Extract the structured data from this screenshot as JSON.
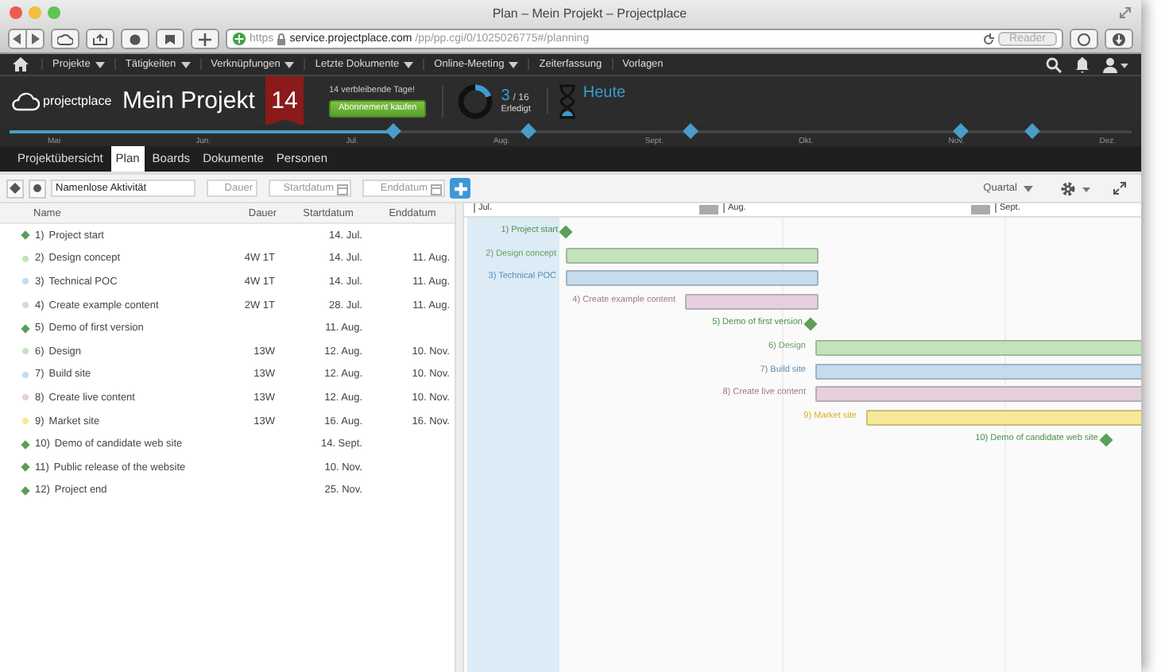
{
  "window": {
    "title": "Plan – Mein Projekt – Projectplace"
  },
  "browser": {
    "url_scheme": "https",
    "url_host": "service.projectplace.com",
    "url_path": "/pp/pp.cgi/0/1025026775#/planning",
    "reader": "Reader"
  },
  "nav": [
    {
      "label": "Projekte",
      "has_menu": true
    },
    {
      "label": "Tätigkeiten",
      "has_menu": true
    },
    {
      "label": "Verknüpfungen",
      "has_menu": true
    },
    {
      "label": "Letzte Dokumente",
      "has_menu": true
    },
    {
      "label": "Online-Meeting",
      "has_menu": true
    },
    {
      "label": "Zeiterfassung",
      "has_menu": false
    },
    {
      "label": "Vorlagen",
      "has_menu": false
    }
  ],
  "header": {
    "logo": "projectplace",
    "project": "Mein Projekt",
    "days_badge": "14",
    "trial_text": "14 verbleibende Tage!",
    "buy_button": "Abonnement kaufen",
    "done_count": "3",
    "total": "/ 16",
    "done_label": "Erledigt",
    "today": "Heute"
  },
  "timeline": {
    "level": 0.34,
    "months": [
      "Mai",
      "Jun.",
      "Jul.",
      "Aug.",
      "Sept.",
      "Okt.",
      "Nov.",
      "Dez."
    ]
  },
  "tabs": [
    {
      "label": "Projektübersicht",
      "selected": false
    },
    {
      "label": "Plan",
      "selected": true
    },
    {
      "label": "Boards",
      "selected": false
    },
    {
      "label": "Dokumente",
      "selected": false
    },
    {
      "label": "Personen",
      "selected": false
    }
  ],
  "toolbar": {
    "name_value": "Namenlose Aktivität",
    "duration_placeholder": "Dauer",
    "start_placeholder": "Startdatum",
    "end_placeholder": "Enddatum",
    "view": "Quartal"
  },
  "table": {
    "columns": [
      "Name",
      "Dauer",
      "Startdatum",
      "Enddatum"
    ],
    "rows": [
      {
        "number": "1)",
        "name": "Project start",
        "start": "14. Jul.",
        "kind": "milestone",
        "color": "#5a9e5a"
      },
      {
        "number": "2)",
        "name": "Design concept",
        "duration": "4W 1T",
        "start": "14. Jul.",
        "end": "11. Aug.",
        "kind": "task",
        "color": "#c4e3bd"
      },
      {
        "number": "3)",
        "name": "Technical POC",
        "duration": "4W 1T",
        "start": "14. Jul.",
        "end": "11. Aug.",
        "kind": "task",
        "color": "#c5dbee"
      },
      {
        "number": "4)",
        "name": "Create example content",
        "duration": "2W 1T",
        "start": "28. Jul.",
        "end": "11. Aug.",
        "kind": "task",
        "color": "#e5d1de"
      },
      {
        "number": "5)",
        "name": "Demo of first version",
        "start": "11. Aug.",
        "kind": "milestone",
        "color": "#5a9e5a"
      },
      {
        "number": "6)",
        "name": "Design",
        "duration": "13W",
        "start": "12. Aug.",
        "end": "10. Nov.",
        "kind": "task",
        "color": "#c4e3bd"
      },
      {
        "number": "7)",
        "name": "Build site",
        "duration": "13W",
        "start": "12. Aug.",
        "end": "10. Nov.",
        "kind": "task",
        "color": "#c5dbee"
      },
      {
        "number": "8)",
        "name": "Create live content",
        "duration": "13W",
        "start": "12. Aug.",
        "end": "10. Nov.",
        "kind": "task",
        "color": "#e5d1de"
      },
      {
        "number": "9)",
        "name": "Market site",
        "duration": "13W",
        "start": "16. Aug.",
        "end": "16. Nov.",
        "kind": "task",
        "color": "#f6e896"
      },
      {
        "number": "10)",
        "name": "Demo of candidate web site",
        "start": "14. Sept.",
        "kind": "milestone",
        "color": "#5a9e5a"
      },
      {
        "number": "11)",
        "name": "Public release of the website",
        "start": "10. Nov.",
        "kind": "milestone",
        "color": "#5a9e5a"
      },
      {
        "number": "12)",
        "name": "Project end",
        "start": "25. Nov.",
        "kind": "milestone",
        "color": "#5a9e5a"
      }
    ]
  },
  "gantt": {
    "months": [
      "Jul.",
      "Aug.",
      "Sept."
    ],
    "items": [
      {
        "label": "1) Project start"
      },
      {
        "label": "2) Design concept"
      },
      {
        "label": "3) Technical POC"
      },
      {
        "label": "4) Create example content"
      },
      {
        "label": "5) Demo of first version"
      },
      {
        "label": "6) Design"
      },
      {
        "label": "7) Build site"
      },
      {
        "label": "8) Create live content"
      },
      {
        "label": "9) Market site"
      },
      {
        "label": "10) Demo of candidate web site"
      }
    ]
  }
}
